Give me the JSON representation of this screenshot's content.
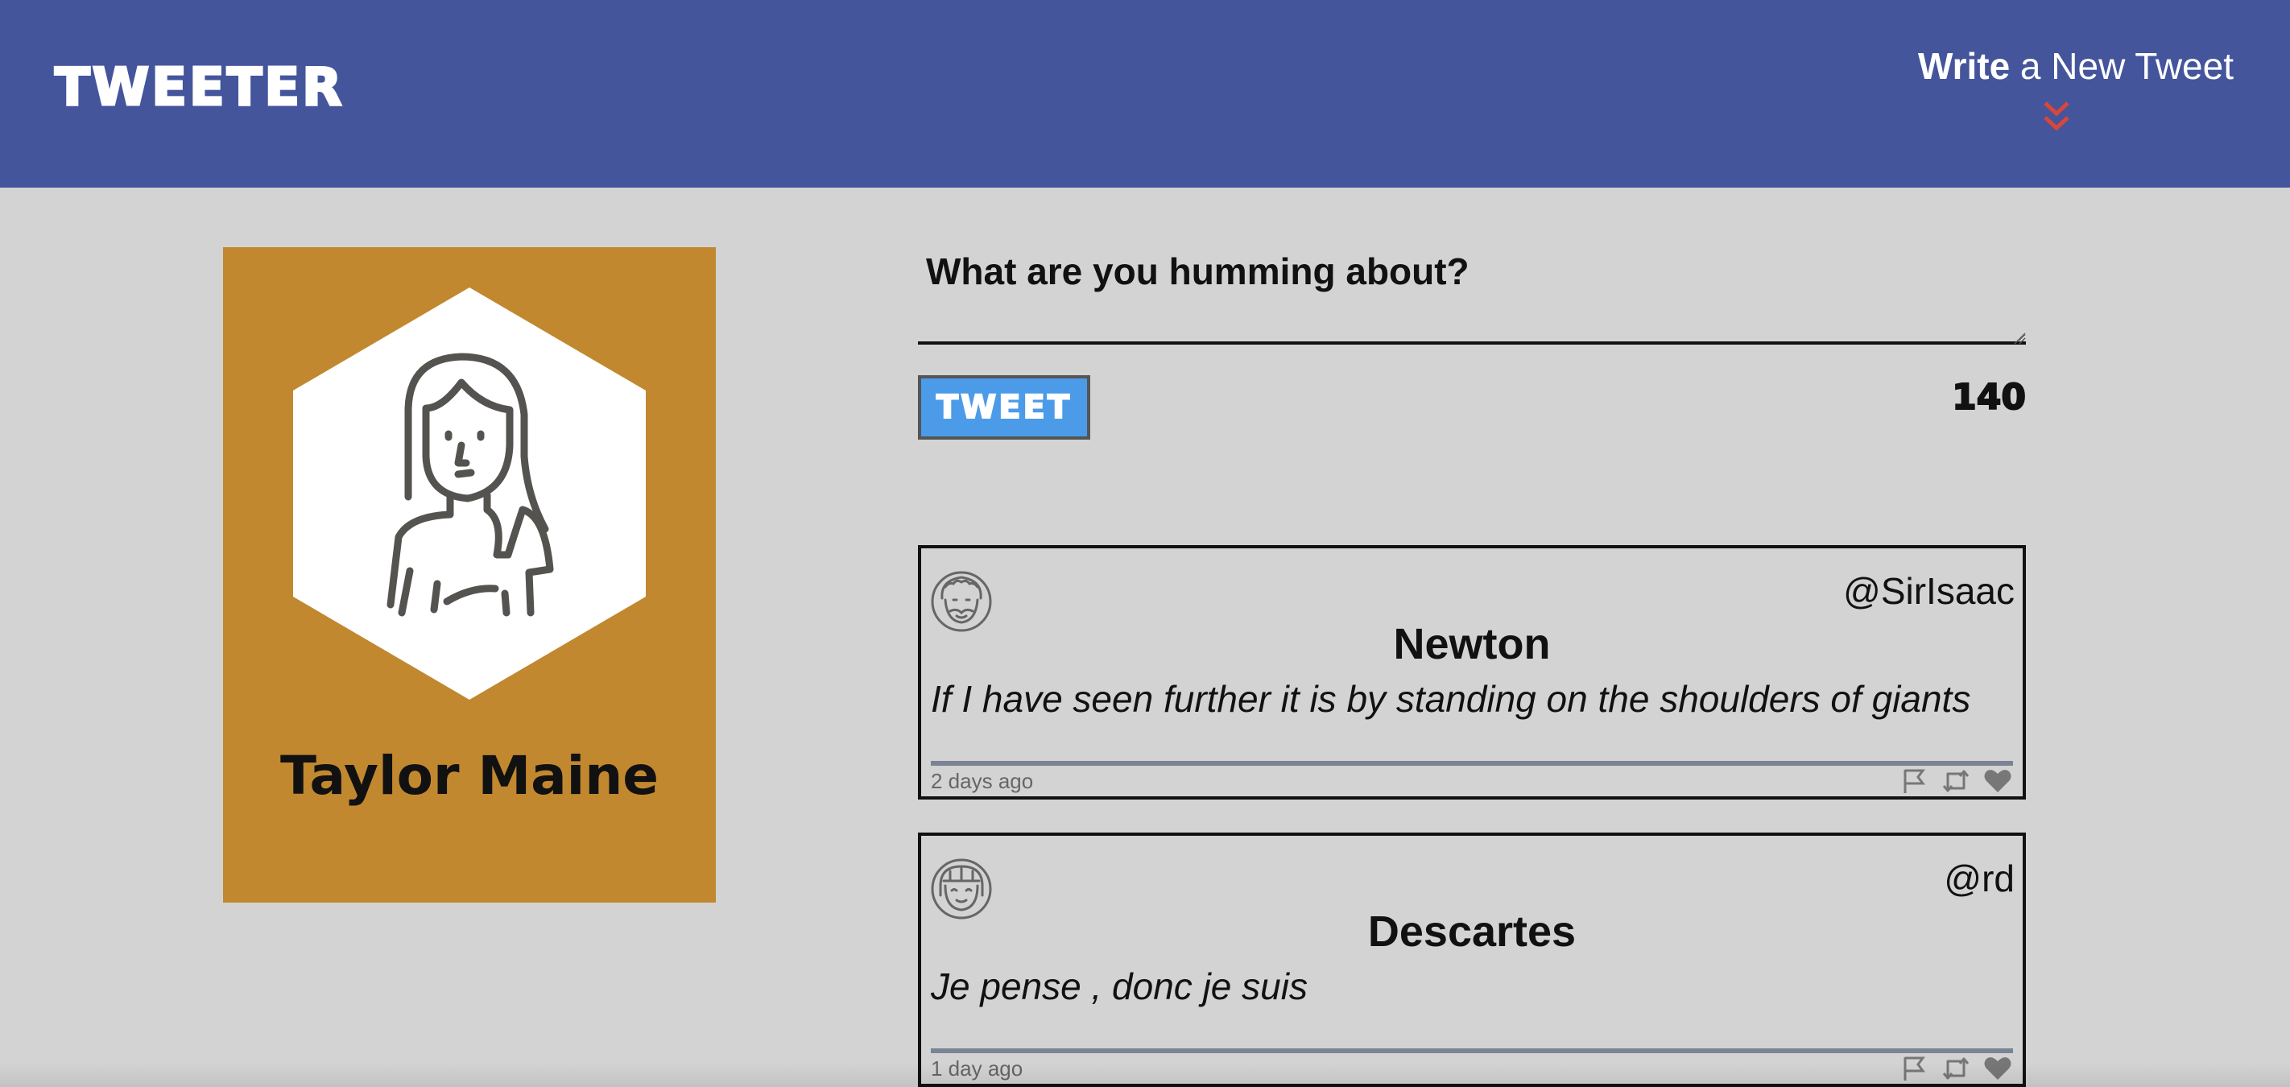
{
  "nav": {
    "brand": "TWEETER",
    "compose_toggle": {
      "bold": "Write",
      "rest": " a New Tweet",
      "icon": "double-chevron-down-icon"
    }
  },
  "profile": {
    "name": "Taylor Maine",
    "avatar_icon": "woman-avatar-icon",
    "card_color": "#c1882f"
  },
  "compose": {
    "placeholder": "What are you humming about?",
    "button_label": "TWEET",
    "counter": "140"
  },
  "tweets": [
    {
      "name": "Newton",
      "handle": "@SirIsaac",
      "content": "If I have seen further it is by standing on the shoulders of giants",
      "time": "2 days ago",
      "avatar_icon": "old-man-avatar-icon"
    },
    {
      "name": "Descartes",
      "handle": "@rd",
      "content": "Je pense , donc je suis",
      "time": "1 day ago",
      "avatar_icon": "girl-avatar-icon"
    }
  ],
  "colors": {
    "nav_bg": "#44559c",
    "page_bg": "#d3d3d3",
    "button_bg": "#4b9be8",
    "chevron": "#d9463a"
  }
}
